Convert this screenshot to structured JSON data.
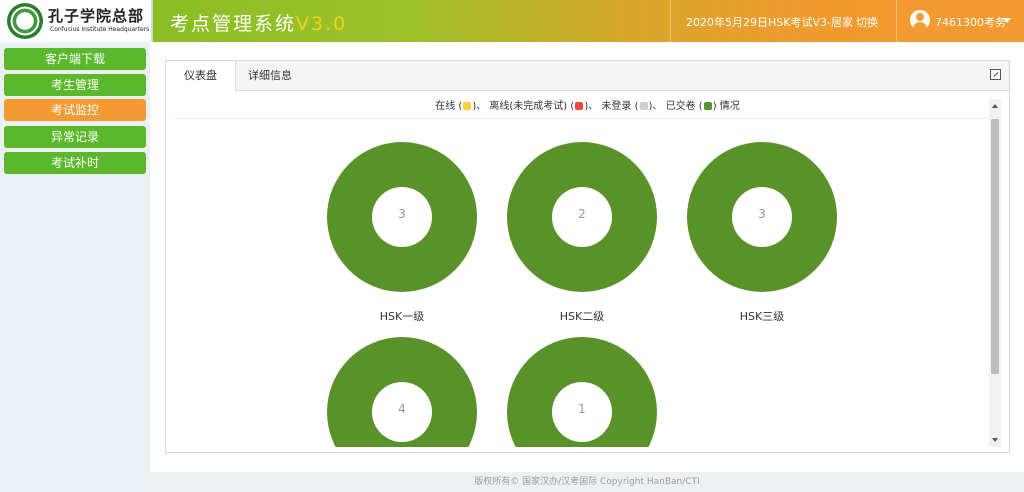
{
  "header": {
    "logo_cn": "孔子学院总部",
    "logo_en": "Confucius Institute Headquarters",
    "app_title": "考点管理系统",
    "app_version": "V3.0",
    "exam_name": "2020年5月29日HSK考试V3-居家",
    "switch_label": "切换",
    "user_name": "7461300考务",
    "colors": {
      "green": "#7cbc1f",
      "orange": "#f39a30"
    }
  },
  "sidebar": {
    "items": [
      {
        "label": "客户端下载",
        "active": false
      },
      {
        "label": "考生管理",
        "active": false
      },
      {
        "label": "考试监控",
        "active": true
      },
      {
        "label": "异常记录",
        "active": false
      },
      {
        "label": "考试补时",
        "active": false
      }
    ]
  },
  "tabs": [
    {
      "label": "仪表盘",
      "active": true
    },
    {
      "label": "详细信息",
      "active": false
    }
  ],
  "legend": {
    "online": "在线",
    "sep1": "、",
    "offline": "离线(未完成考试)",
    "sep2": "、",
    "not_logged": "未登录",
    "sep3": "、",
    "submitted": "已交卷",
    "suffix": "情况",
    "colors": {
      "online": "#f7d046",
      "offline": "#e74c3c",
      "not_logged": "#cfcfcf",
      "submitted": "#5a922a"
    }
  },
  "chart_data": {
    "type": "pie",
    "charts": [
      {
        "label": "HSK一级",
        "count": "3",
        "submitted": 3
      },
      {
        "label": "HSK二级",
        "count": "2",
        "submitted": 2
      },
      {
        "label": "HSK三级",
        "count": "3",
        "submitted": 3
      },
      {
        "label": "",
        "count": "4",
        "submitted": 4
      },
      {
        "label": "",
        "count": "1",
        "submitted": 1
      }
    ]
  },
  "footer": {
    "text": "版权所有© 国家汉办/汉考国际 Copyright HanBan/CTI"
  }
}
